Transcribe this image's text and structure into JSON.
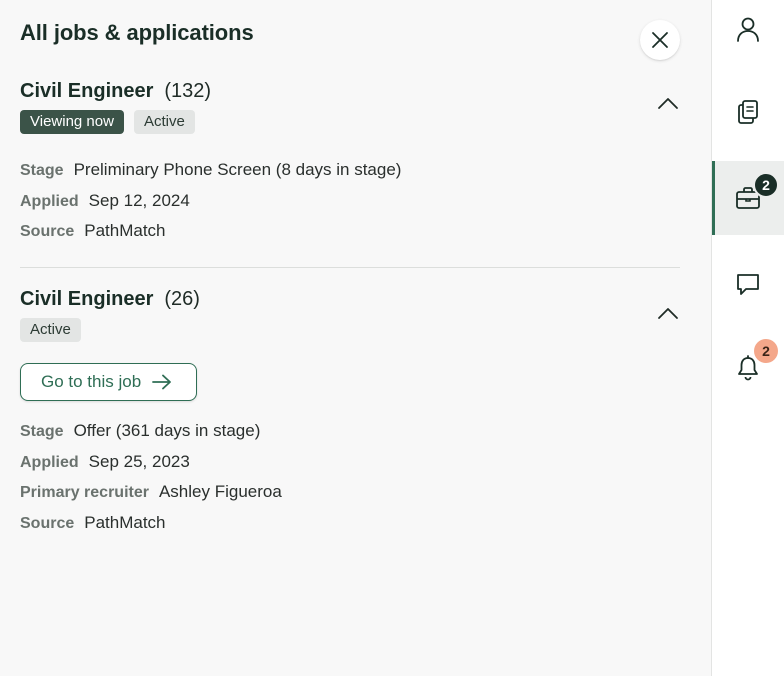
{
  "panel": {
    "title": "All jobs & applications"
  },
  "jobs": [
    {
      "title": "Civil Engineer",
      "count": "(132)",
      "badges": [
        "Viewing now",
        "Active"
      ],
      "details": [
        {
          "label": "Stage",
          "value": "Preliminary Phone Screen (8 days in stage)"
        },
        {
          "label": "Applied",
          "value": "Sep 12, 2024"
        },
        {
          "label": "Source",
          "value": "PathMatch"
        }
      ]
    },
    {
      "title": "Civil Engineer",
      "count": "(26)",
      "badges": [
        "Active"
      ],
      "go_button_label": "Go to this job",
      "details": [
        {
          "label": "Stage",
          "value": "Offer (361 days in stage)"
        },
        {
          "label": "Applied",
          "value": "Sep 25, 2023"
        },
        {
          "label": "Primary recruiter",
          "value": "Ashley Figueroa"
        },
        {
          "label": "Source",
          "value": "PathMatch"
        }
      ]
    }
  ],
  "rail": {
    "items": [
      {
        "icon": "person-icon"
      },
      {
        "icon": "documents-icon"
      },
      {
        "icon": "briefcase-icon",
        "badge": "2",
        "active": true
      },
      {
        "icon": "chat-icon"
      },
      {
        "icon": "bell-icon",
        "badge": "2"
      }
    ]
  },
  "colors": {
    "accent": "#2f6e55",
    "dark_badge": "#3b5348",
    "notification_badge": "#f4a78a"
  }
}
